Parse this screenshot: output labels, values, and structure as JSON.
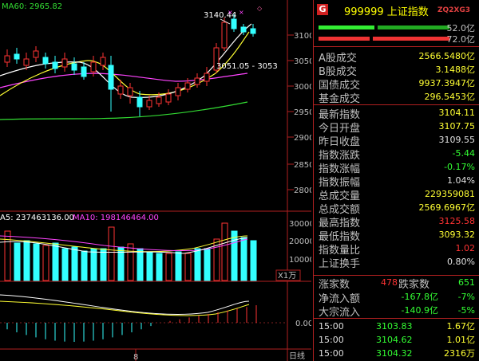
{
  "chart": {
    "ma60_label": "MA60: 2965.82",
    "price_ticks": [
      "3100",
      "3050",
      "3000",
      "2950",
      "2900",
      "2850",
      "2800"
    ],
    "high_annotation": "3140.44",
    "range_annotation": "3051.05 - 3053",
    "volume_legend_a": "A5: 237463136.00",
    "volume_legend_b": "MA10: 198146464.00",
    "volume_ticks": [
      "30000",
      "20000",
      "10000"
    ],
    "volume_unit": "X1万",
    "macd_tick": "0.00",
    "date_label": "8",
    "period_label": "日线"
  },
  "colors": {
    "up": "#ff3333",
    "down": "#33ffff",
    "ma_white": "#ffffff",
    "ma_yellow": "#ffff33",
    "ma_magenta": "#ff44ff",
    "ma_green": "#33dd33",
    "grid": "#b02020"
  },
  "panel": {
    "badge": "G",
    "title": "999999 上证指数",
    "tag": "ZQ2XG3",
    "bar_values": [
      "52.0亿",
      "72.0亿"
    ],
    "rows": [
      {
        "label": "A股成交",
        "value": "2566.5480亿"
      },
      {
        "label": "B股成交",
        "value": "3.1488亿"
      },
      {
        "label": "国债成交",
        "value": "9937.3947亿"
      },
      {
        "label": "基金成交",
        "value": "296.5453亿"
      },
      {
        "label": "最新指数",
        "value": "3104.11"
      },
      {
        "label": "今日开盘",
        "value": "3107.75"
      },
      {
        "label": "昨日收盘",
        "value": "3109.55"
      },
      {
        "label": "指数涨跌",
        "value": "-5.44"
      },
      {
        "label": "指数涨幅",
        "value": "-0.17%"
      },
      {
        "label": "指数振幅",
        "value": "1.04%"
      },
      {
        "label": "总成交量",
        "value": "229359081"
      },
      {
        "label": "总成交额",
        "value": "2569.6967亿"
      },
      {
        "label": "最高指数",
        "value": "3125.58"
      },
      {
        "label": "最低指数",
        "value": "3093.32"
      },
      {
        "label": "指数量比",
        "value": "1.02"
      },
      {
        "label": "上证换手",
        "value": "0.80%"
      }
    ],
    "breadth": {
      "up_label": "涨家数",
      "up_value": "478",
      "down_label": "跌家数",
      "down_value": "651"
    },
    "flows": [
      {
        "label": "净流入额",
        "value": "-167.8亿",
        "pct": "-7%"
      },
      {
        "label": "大宗流入",
        "value": "-140.9亿",
        "pct": "-5%"
      }
    ],
    "trades": [
      {
        "time": "15:00",
        "price": "3103.83",
        "vol": "1.67亿"
      },
      {
        "time": "15:00",
        "price": "3104.62",
        "vol": "1.01亿"
      },
      {
        "time": "15:00",
        "price": "3104.32",
        "vol": "2316万"
      }
    ]
  }
}
